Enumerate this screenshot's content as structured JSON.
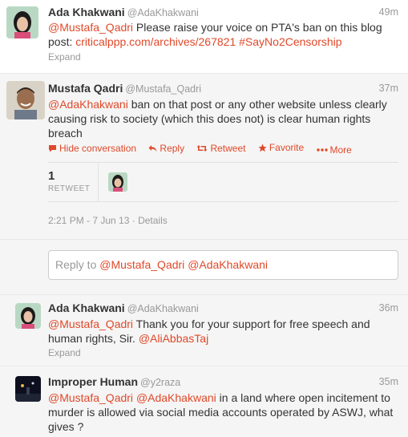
{
  "tweets": [
    {
      "name": "Ada Khakwani",
      "handle": "@AdaKhakwani",
      "time": "49m",
      "text_lines": [
        [
          "@Mustafa_Qadri",
          " Please raise your voice on PTA's ban on this blog"
        ],
        [
          "post: ",
          "criticalppp.com/archives/267821",
          " ",
          "#SayNo2Censorship"
        ]
      ],
      "expand": "Expand"
    },
    {
      "name": "Mustafa Qadri",
      "handle": "@Mustafa_Qadri",
      "time": "37m",
      "line1_mention": "@AdaKhakwani",
      "line1_rest": " ban on that post or any other website unless clearly",
      "line2": "causing risk to society (which this does not) is clear human rights",
      "line3": "breach",
      "actions": {
        "hide": "Hide conversation",
        "reply": "Reply",
        "retweet": "Retweet",
        "favorite": "Favorite",
        "more": "More"
      },
      "retweet_count": "1",
      "retweet_label": "RETWEET",
      "datetime": "2:21 PM - 7 Jun 13",
      "details": "Details"
    },
    {
      "name": "Ada Khakwani",
      "handle": "@AdaKhakwani",
      "time": "36m",
      "line1_mention": "@Mustafa_Qadri",
      "line1_rest": " Thank you for your support for free speech and",
      "line2_pre": "human rights, Sir. ",
      "line2_mention": "@AliAbbasTaj",
      "expand": "Expand"
    },
    {
      "name": "Improper Human",
      "handle": "@y2raza",
      "time": "35m",
      "line1_m1": "@Mustafa_Qadri",
      "line1_m2": "@AdaKhakwani",
      "line1_rest": " in a land where open incitement to",
      "line2": "murder is allowed via social media accounts operated by ASWJ, what",
      "line3": "gives ?"
    }
  ],
  "reply_box": {
    "prefix": "Reply to ",
    "mention1": "@Mustafa_Qadri",
    "mention2": "@AdaKhakwani"
  },
  "colors": {
    "link": "#e0492a",
    "muted": "#999999",
    "text": "#333333"
  }
}
